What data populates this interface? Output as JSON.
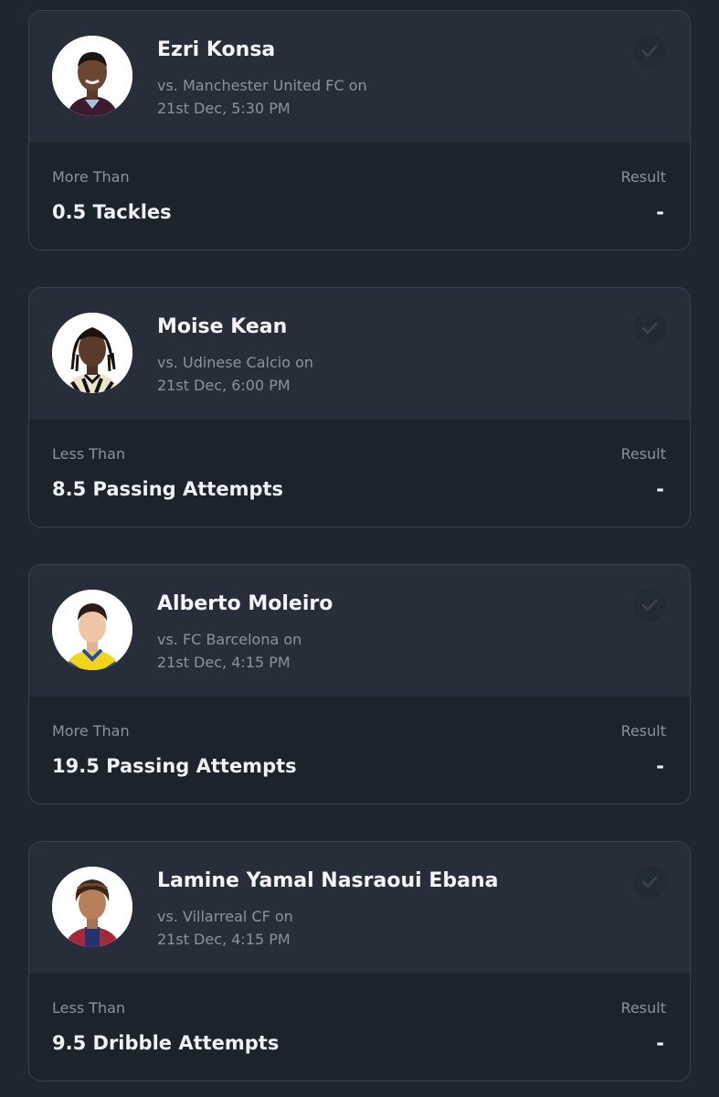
{
  "picks": [
    {
      "player": "Ezri Konsa",
      "avatar_icon": "player-photo",
      "opponent_line": "vs. Manchester United FC on",
      "datetime": "21st Dec, 5:30 PM",
      "direction": "More Than",
      "prop": "0.5 Tackles",
      "result_label": "Result",
      "result_value": "-"
    },
    {
      "player": "Moise Kean",
      "avatar_icon": "player-photo",
      "opponent_line": "vs. Udinese Calcio on",
      "datetime": "21st Dec, 6:00 PM",
      "direction": "Less Than",
      "prop": "8.5 Passing Attempts",
      "result_label": "Result",
      "result_value": "-"
    },
    {
      "player": "Alberto Moleiro",
      "avatar_icon": "player-photo",
      "opponent_line": "vs. FC Barcelona on",
      "datetime": "21st Dec, 4:15 PM",
      "direction": "More Than",
      "prop": "19.5 Passing Attempts",
      "result_label": "Result",
      "result_value": "-"
    },
    {
      "player": "Lamine Yamal Nasraoui Ebana",
      "avatar_icon": "player-photo",
      "opponent_line": "vs. Villarreal CF on",
      "datetime": "21st Dec, 4:15 PM",
      "direction": "Less Than",
      "prop": "9.5 Dribble Attempts",
      "result_label": "Result",
      "result_value": "-"
    }
  ],
  "colors": {
    "page_bg": "#1f2630",
    "card_top_bg": "#272e3a",
    "card_bottom_bg": "#1c232d",
    "muted_text": "#8a929e",
    "primary_text": "#f3f5f8"
  }
}
